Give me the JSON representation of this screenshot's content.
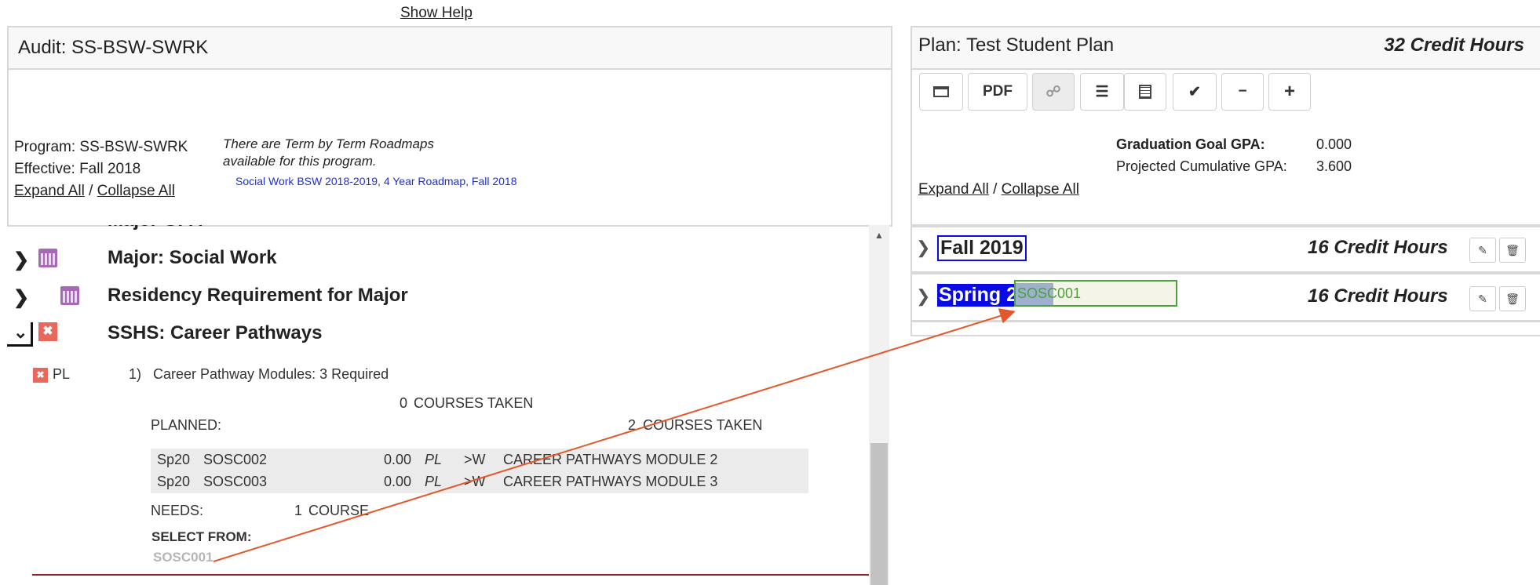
{
  "show_help": "Show Help",
  "audit": {
    "title": "Audit: SS-BSW-SWRK",
    "program": "Program: SS-BSW-SWRK",
    "effective": "Effective: Fall 2018",
    "expand_all": "Expand All",
    "sep": "/",
    "collapse_all": "Collapse All",
    "roadmap_note_1": "There are Term by Term Roadmaps",
    "roadmap_note_2": "available for this program.",
    "roadmap_link": "Social Work BSW 2018-2019, 4 Year Roadmap, Fall 2018",
    "cut_off_heading": "Major GPA",
    "sections": [
      {
        "label": "Major: Social Work"
      },
      {
        "label": "Residency Requirement for Major"
      },
      {
        "label": "SSHS: Career Pathways"
      }
    ],
    "requirement": {
      "status": "PL",
      "number": "1)",
      "text": "Career Pathway Modules: 3 Required",
      "taken_count": "0",
      "taken_label": "COURSES TAKEN",
      "planned_label": "PLANNED:",
      "planned_count": "2",
      "planned_count_label": "COURSES TAKEN",
      "courses": [
        {
          "term": "Sp20",
          "code": "SOSC002",
          "hours": "0.00",
          "grade": "PL",
          "flag": ">W",
          "title": "CAREER PATHWAYS MODULE 2"
        },
        {
          "term": "Sp20",
          "code": "SOSC003",
          "hours": "0.00",
          "grade": "PL",
          "flag": ">W",
          "title": "CAREER PATHWAYS MODULE 3"
        }
      ],
      "needs_label": "NEEDS:",
      "needs_value": "1",
      "needs_unit": "COURSE",
      "select_from": "SELECT FROM:",
      "select_course": "SOSC001"
    }
  },
  "plan": {
    "title": "Plan: Test Student Plan",
    "credit_hours": "32 Credit Hours",
    "toolbar": {
      "pdf": "PDF"
    },
    "grad_goal_label": "Graduation Goal GPA:",
    "grad_goal_value": "0.000",
    "proj_label": "Projected Cumulative GPA:",
    "proj_value": "3.600",
    "expand_all": "Expand All",
    "sep": "/",
    "collapse_all": "Collapse All",
    "terms": [
      {
        "name": "Fall 2019",
        "hours": "16 Credit Hours"
      },
      {
        "name": "Spring 2020",
        "hours": "16 Credit Hours"
      }
    ],
    "drag_chip": "SOSC001"
  },
  "colors": {
    "accent_blue": "#0a0ae6",
    "drag_line": "#e2582d",
    "planned_x": "#e9685b",
    "calendar": "#a768b8"
  }
}
